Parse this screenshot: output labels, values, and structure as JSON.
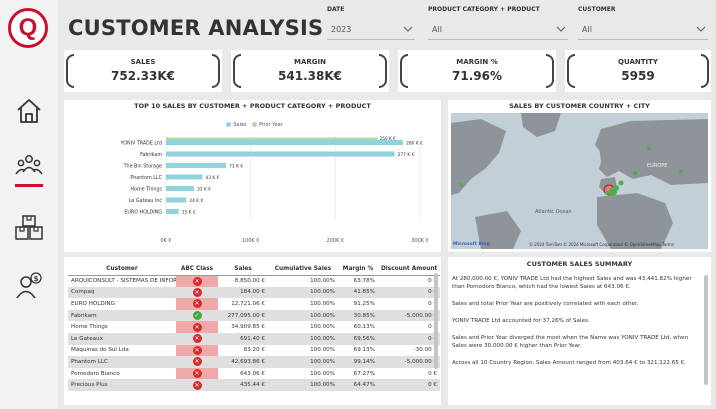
{
  "header": {
    "title": "CUSTOMER ANALYSIS"
  },
  "filters": [
    {
      "label": "DATE",
      "value": "2023"
    },
    {
      "label": "PRODUCT CATEGORY + PRODUCT",
      "value": "All"
    },
    {
      "label": "CUSTOMER",
      "value": "All"
    }
  ],
  "sidebar": {
    "logo_letter": "Q",
    "items": [
      {
        "icon": "home-icon"
      },
      {
        "icon": "customers-icon"
      },
      {
        "icon": "products-icon"
      },
      {
        "icon": "person-info-icon"
      }
    ]
  },
  "kpis": [
    {
      "label": "SALES",
      "value": "752.33K€"
    },
    {
      "label": "MARGIN",
      "value": "541.38K€"
    },
    {
      "label": "MARGIN %",
      "value": "71.96%"
    },
    {
      "label": "QUANTITY",
      "value": "5959"
    }
  ],
  "bar_panel": {
    "title": "TOP 10 SALES BY CUSTOMER + PRODUCT CATEGORY + PRODUCT",
    "legend_sales": "Sales",
    "legend_prior": "Prior Year"
  },
  "chart_data": {
    "type": "bar",
    "orientation": "horizontal",
    "title": "TOP 10 SALES BY CUSTOMER + PRODUCT CATEGORY + PRODUCT",
    "categories": [
      "YONIV TRADE Ltd",
      "Fabrikam",
      "The Bin Storage",
      "Phantom LLC",
      "Home Things",
      "Le Gateau Inc",
      "EURO HOLDING"
    ],
    "series": [
      {
        "name": "Sales",
        "values": [
          280,
          270,
          71,
          43,
          33,
          24,
          15
        ]
      },
      {
        "name": "Prior Year",
        "values": [
          250,
          0,
          0,
          0,
          0,
          0,
          0
        ]
      }
    ],
    "data_labels": [
      "280 K €",
      "277 K €",
      "71 K €",
      "43 K €",
      "33 K €",
      "24 K €",
      "15 K €"
    ],
    "prior_labels": [
      "250 K €"
    ],
    "x_ticks": [
      "0K €",
      "100K €",
      "200K €",
      "300K €"
    ],
    "xlim": [
      0,
      300
    ],
    "colors": {
      "sales": "#8fd3dc",
      "prior": "#b4d8a8"
    }
  },
  "map_panel": {
    "title": "SALES BY CUSTOMER COUNTRY + CITY",
    "labels": [
      "EUROPE",
      "Atlantic Ocean"
    ],
    "attribution": "© 2024 TomTom © 2024 Microsoft Corporation © OpenStreetMap Terms",
    "bing_label": "Microsoft Bing"
  },
  "table": {
    "columns": [
      "Customer",
      "ABC Class",
      "Sales",
      "Cumulative Sales",
      "Margin %",
      "Discount Amount"
    ],
    "rows": [
      {
        "customer": "ARQUICONSULT - SISTEMAS DE INFORMAÇÃO, S.A.",
        "abc": "C",
        "sales": "8,850.00 €",
        "cum": "100.00%",
        "margin": "63.78%",
        "discount": "0 €",
        "highlight": false
      },
      {
        "customer": "Compaq",
        "abc": "C",
        "sales": "184.00 €",
        "cum": "100.00%",
        "margin": "41.85%",
        "discount": "0 €",
        "highlight": true
      },
      {
        "customer": "EURO HOLDING",
        "abc": "C",
        "sales": "12,721.06 €",
        "cum": "100.00%",
        "margin": "91.25%",
        "discount": "0 €",
        "highlight": false
      },
      {
        "customer": "Fabrikam",
        "abc": "A",
        "sales": "277,095.00 €",
        "cum": "100.00%",
        "margin": "30.85%",
        "discount": "-5,000.00 €",
        "highlight": true
      },
      {
        "customer": "Home Things",
        "abc": "C",
        "sales": "34,909.85 €",
        "cum": "100.00%",
        "margin": "60.13%",
        "discount": "0 €",
        "highlight": false
      },
      {
        "customer": "Le Gateaux",
        "abc": "C",
        "sales": "691.40 €",
        "cum": "100.00%",
        "margin": "69.56%",
        "discount": "0 €",
        "highlight": true
      },
      {
        "customer": "Máquinas do Sul Lda",
        "abc": "C",
        "sales": "83.20 €",
        "cum": "100.00%",
        "margin": "69.13%",
        "discount": "-30.00 €",
        "highlight": false
      },
      {
        "customer": "Phantom LLC",
        "abc": "C",
        "sales": "42,693.86 €",
        "cum": "100.00%",
        "margin": "99.14%",
        "discount": "-5,000.00 €",
        "highlight": true
      },
      {
        "customer": "Pomodoro Bianco",
        "abc": "C",
        "sales": "643.06 €",
        "cum": "100.00%",
        "margin": "67.27%",
        "discount": "0 €",
        "highlight": false
      },
      {
        "customer": "Precious Plus",
        "abc": "C",
        "sales": "435.44 €",
        "cum": "100.00%",
        "margin": "64.47%",
        "discount": "0 €",
        "highlight": true
      }
    ]
  },
  "summary": {
    "title": "CUSTOMER SALES SUMMARY",
    "paragraphs": [
      "At 280,000.00 €, YONIV TRADE Ltd had the highest Sales and was 43,441.82% higher than Pomodoro Bianco, which had the lowest Sales at 643.06 €.",
      "Sales and total Prior Year are positively correlated with each other.",
      "YONIV TRADE Ltd accounted for 37.26% of Sales.",
      "Sales and Prior Year diverged the most when the Name was YONIV TRADE Ltd, when Sales were 30,000.00 € higher than Prior Year.",
      "Across all 10 Country Region, Sales Amount ranged from 403.64 € to 321,122.65 €."
    ]
  }
}
